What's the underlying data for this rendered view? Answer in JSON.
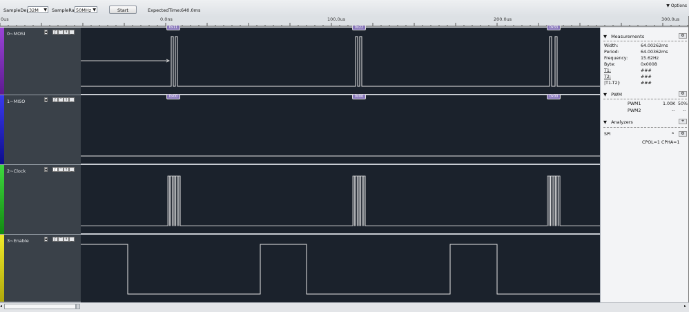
{
  "toolbar": {
    "sample_depth_label": "SampleDepth",
    "sample_depth_value": "32M",
    "sample_rate_label": "SampleRate",
    "sample_rate_value": "50MHz",
    "start_label": "Start",
    "expected_time_label": "ExpectedTime:",
    "expected_time_value": "640.0ms",
    "options_label": "Options"
  },
  "ruler": {
    "left_label": "0us",
    "ticks": [
      "0.0ns",
      "100.0us",
      "200.0us",
      "300.0us"
    ]
  },
  "channels": [
    {
      "name": "0~MOSI",
      "color": "#7a2fb3",
      "decodes": [
        "0x11",
        "0x22",
        "0x33"
      ]
    },
    {
      "name": "1~MISO",
      "color": "#2a2ad0",
      "decodes": [
        "0x00",
        "0x00",
        "0x00"
      ]
    },
    {
      "name": "2~Clock",
      "color": "#22b022"
    },
    {
      "name": "3~Enable",
      "color": "#d4cf1a"
    }
  ],
  "measurements": {
    "title": "Measurements",
    "rows": [
      {
        "label": "Width:",
        "value": "64.00262ms"
      },
      {
        "label": "Period:",
        "value": "64.00362ms"
      },
      {
        "label": "Frequency:",
        "value": "15.62Hz"
      },
      {
        "label": "Byte:",
        "value": "0x0008"
      },
      {
        "label": "T1:",
        "value": "###"
      },
      {
        "label": "T2:",
        "value": "###"
      },
      {
        "label": "|T1-T2|:",
        "value": "###"
      }
    ]
  },
  "pwm": {
    "title": "PWM",
    "rows": [
      {
        "label": "PWM1",
        "value": "1.00K",
        "duty": "50%"
      },
      {
        "label": "PWM2",
        "value": "--",
        "duty": "--"
      }
    ]
  },
  "analyzers": {
    "title": "Analyzers",
    "name": "SPI",
    "settings": "CPOL=1 CPHA=1"
  }
}
